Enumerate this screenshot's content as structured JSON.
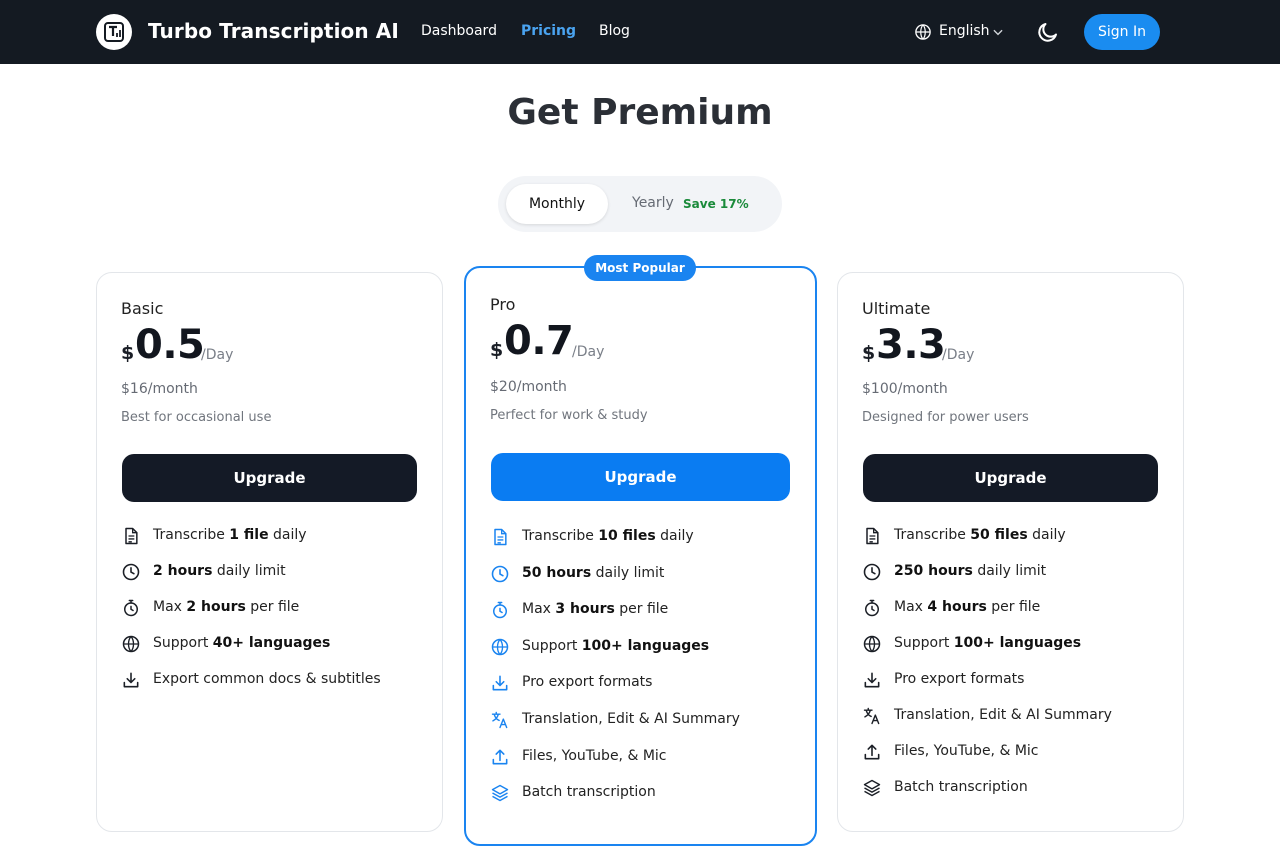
{
  "header": {
    "brand": "Turbo Transcription AI",
    "nav": [
      "Dashboard",
      "Pricing",
      "Blog"
    ],
    "active_nav": "Pricing",
    "language": "English",
    "signin": "Sign In",
    "accent_color": "#1a8cf0"
  },
  "page": {
    "title": "Get Premium"
  },
  "billing_toggle": {
    "monthly": "Monthly",
    "yearly": "Yearly",
    "save": "Save 17%",
    "selected": "Monthly"
  },
  "plans": [
    {
      "name": "Basic",
      "currency": "$",
      "price": "0.5",
      "per": "/Day",
      "monthly": "$16/month",
      "description": "Best for occasional use",
      "button": "Upgrade",
      "features": [
        {
          "pre": "Transcribe ",
          "bold": "1 file",
          "post": " daily",
          "icon": "file-icon"
        },
        {
          "pre": "",
          "bold": "2 hours",
          "post": " daily limit",
          "icon": "clock-icon"
        },
        {
          "pre": "Max ",
          "bold": "2 hours",
          "post": " per file",
          "icon": "timer-icon"
        },
        {
          "pre": "Support ",
          "bold": "40+ languages",
          "post": "",
          "icon": "globe-icon"
        },
        {
          "pre": "Export common docs & subtitles",
          "bold": "",
          "post": "",
          "icon": "download-icon"
        }
      ]
    },
    {
      "name": "Pro",
      "badge": "Most Popular",
      "currency": "$",
      "price": "0.7",
      "per": "/Day",
      "monthly": "$20/month",
      "description": "Perfect for work & study",
      "button": "Upgrade",
      "features": [
        {
          "pre": "Transcribe ",
          "bold": "10 files",
          "post": " daily",
          "icon": "file-icon"
        },
        {
          "pre": "",
          "bold": "50 hours",
          "post": " daily limit",
          "icon": "clock-icon"
        },
        {
          "pre": "Max ",
          "bold": "3 hours",
          "post": " per file",
          "icon": "timer-icon"
        },
        {
          "pre": "Support ",
          "bold": "100+ languages",
          "post": "",
          "icon": "globe-icon"
        },
        {
          "pre": "Pro export formats",
          "bold": "",
          "post": "",
          "icon": "download-icon"
        },
        {
          "pre": "Translation, Edit & AI Summary",
          "bold": "",
          "post": "",
          "icon": "translate-icon"
        },
        {
          "pre": "Files, YouTube, & Mic",
          "bold": "",
          "post": "",
          "icon": "upload-icon"
        },
        {
          "pre": "Batch transcription",
          "bold": "",
          "post": "",
          "icon": "layers-icon"
        }
      ]
    },
    {
      "name": "Ultimate",
      "currency": "$",
      "price": "3.3",
      "per": "/Day",
      "monthly": "$100/month",
      "description": "Designed for power users",
      "button": "Upgrade",
      "features": [
        {
          "pre": "Transcribe ",
          "bold": "50 files",
          "post": " daily",
          "icon": "file-icon"
        },
        {
          "pre": "",
          "bold": "250 hours",
          "post": " daily limit",
          "icon": "clock-icon"
        },
        {
          "pre": "Max ",
          "bold": "4 hours",
          "post": " per file",
          "icon": "timer-icon"
        },
        {
          "pre": "Support ",
          "bold": "100+ languages",
          "post": "",
          "icon": "globe-icon"
        },
        {
          "pre": "Pro export formats",
          "bold": "",
          "post": "",
          "icon": "download-icon"
        },
        {
          "pre": "Translation, Edit & AI Summary",
          "bold": "",
          "post": "",
          "icon": "translate-icon"
        },
        {
          "pre": "Files, YouTube, & Mic",
          "bold": "",
          "post": "",
          "icon": "upload-icon"
        },
        {
          "pre": "Batch transcription",
          "bold": "",
          "post": "",
          "icon": "layers-icon"
        }
      ]
    }
  ]
}
